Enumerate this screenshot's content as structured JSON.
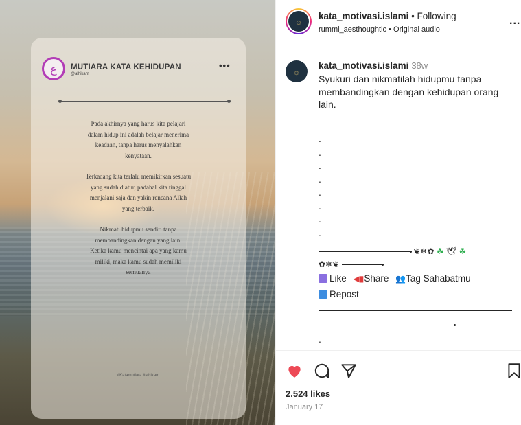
{
  "media": {
    "card": {
      "title": "MUTIARA KATA KEHIDUPAN",
      "handle": "@alhikam",
      "more": "•••",
      "paragraphs": [
        "Pada akhirnya yang harus kita pelajari\ndalam hidup ini adalah belajar menerima\nkeadaan, tanpa harus menyalahkan\nkenyataan.",
        "Terkadang kita terlalu memikirkan sesuatu\nyang sudah diatur, padahal kita tinggal\nmenjalani saja  dan yakin rencana Allah\nyang terbaik.",
        "Nikmati hidupmu sendiri tanpa\nmembandingkan dengan yang lain.\nKetika kamu mencintai apa yang kamu\nmiliki, maka kamu sudah memiliki\nsemuanya"
      ],
      "footer": "#Katamutiara #alhikam"
    }
  },
  "header": {
    "username": "kata_motivasi.islami",
    "follow_status": " • Following",
    "audio": "rummi_aesthoughtic • Original audio",
    "more": "..."
  },
  "caption": {
    "username": "kata_motivasi.islami",
    "time": "38w",
    "text": "Syukuri dan nikmatilah hidupmu tanpa membandingkan dengan kehidupan orang lain.",
    "deco_1": "❦❄✿",
    "deco_2": "✿❄❦",
    "like_label": "Like",
    "share_label": "Share",
    "tag_label": "Tag Sahabatmu",
    "repost_label": "Repost"
  },
  "footer": {
    "likes": "2.524 likes",
    "date": "January 17"
  },
  "colors": {
    "like_heart": "#ed4956",
    "accent_ring": "#b23cb6",
    "muted": "#8e8e8e"
  },
  "icons": [
    "heart-icon",
    "comment-icon",
    "share-icon",
    "bookmark-icon"
  ]
}
